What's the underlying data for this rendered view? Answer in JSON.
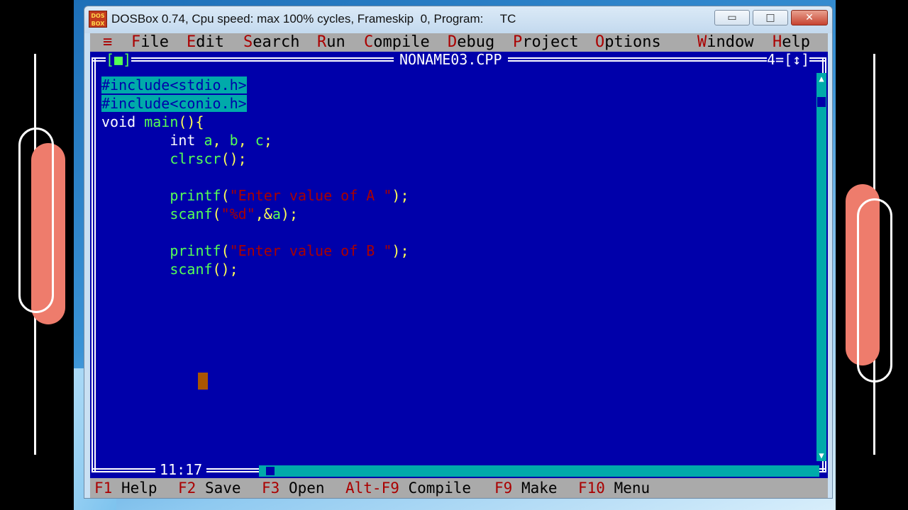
{
  "window": {
    "title": "DOSBox 0.74, Cpu speed: max 100% cycles, Frameskip  0, Program:     TC",
    "icon_text": "DOS BOX",
    "minimize_glyph": "▭",
    "maximize_glyph": "□",
    "close_glyph": "✕"
  },
  "menu": {
    "system": "≡",
    "items": [
      {
        "hot": "F",
        "rest": "ile"
      },
      {
        "hot": "E",
        "rest": "dit"
      },
      {
        "hot": "S",
        "rest": "earch"
      },
      {
        "hot": "R",
        "rest": "un"
      },
      {
        "hot": "C",
        "rest": "ompile"
      },
      {
        "hot": "D",
        "rest": "ebug"
      },
      {
        "hot": "P",
        "rest": "roject"
      },
      {
        "hot": "O",
        "rest": "ptions"
      },
      {
        "hot": "W",
        "rest": "indow"
      },
      {
        "hot": "H",
        "rest": "elp"
      }
    ]
  },
  "editor": {
    "filename": "NONAME03.CPP",
    "close_box": "[■]",
    "window_number": "4=[↕]",
    "cursor_position": "11:17",
    "lines": [
      [
        "#include<stdio.h>"
      ],
      [
        "#include<conio.h>"
      ],
      [
        "void",
        " ",
        "main",
        "(){"
      ],
      [
        "        ",
        "int",
        " ",
        "a",
        ", ",
        "b",
        ", ",
        "c",
        ";"
      ],
      [
        "        ",
        "clrscr",
        "();"
      ],
      [
        ""
      ],
      [
        "        ",
        "printf",
        "(",
        "\"Enter value of A \"",
        ");"
      ],
      [
        "        ",
        "scanf",
        "(",
        "\"%d\"",
        ",&",
        "a",
        ");"
      ],
      [
        ""
      ],
      [
        "        ",
        "printf",
        "(",
        "\"Enter value of B \"",
        ");"
      ],
      [
        "        ",
        "scanf",
        "();"
      ]
    ]
  },
  "status": {
    "items": [
      {
        "key": "F1",
        "label": " Help"
      },
      {
        "key": "F2",
        "label": " Save"
      },
      {
        "key": "F3",
        "label": " Open"
      },
      {
        "key": "Alt-F9",
        "label": " Compile"
      },
      {
        "key": "F9",
        "label": " Make"
      },
      {
        "key": "F10",
        "label": " Menu"
      }
    ]
  },
  "colors": {
    "editor_bg": "#0000aa",
    "menu_bg": "#aaaaaa",
    "hotkey": "#aa0000",
    "keyword": "#ffffff",
    "identifier": "#55ff55",
    "punctuation": "#ffff55",
    "string": "#aa0000",
    "selection": "#00aaaa",
    "cursor": "#aa5500",
    "accent_pill": "#ee7c6c"
  }
}
